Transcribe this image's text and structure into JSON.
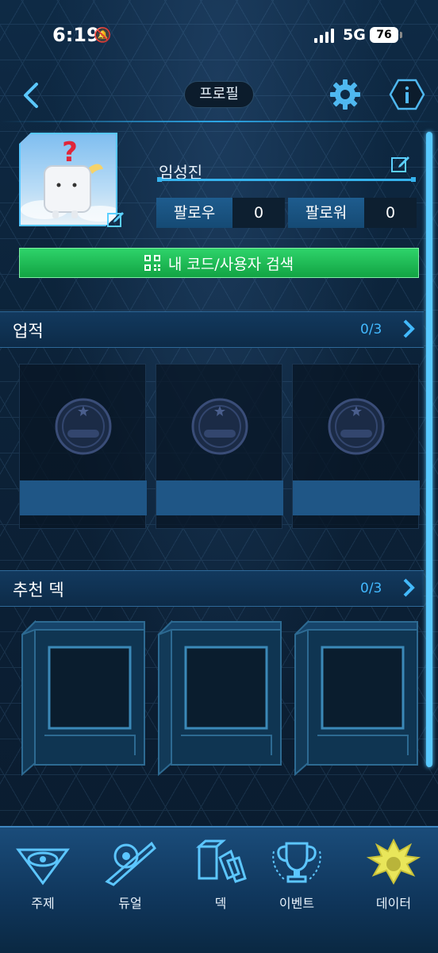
{
  "status_bar": {
    "time": "6:19",
    "network": "5G",
    "battery": "76"
  },
  "header": {
    "title": "프로필"
  },
  "profile": {
    "name": "임성진",
    "follow_label": "팔로우",
    "follow_value": "0",
    "follower_label": "팔로워",
    "follower_value": "0",
    "qr_button_label": "내 코드/사용자 검색"
  },
  "achievements": {
    "title": "업적",
    "count": "0/3"
  },
  "recommended_decks": {
    "title": "추천 덱",
    "count": "0/3"
  },
  "nav": {
    "items": [
      {
        "label": "주제",
        "icon": "millennium-eye-icon"
      },
      {
        "label": "듀얼",
        "icon": "duel-disk-icon"
      },
      {
        "label": "덱",
        "icon": "deck-icon"
      },
      {
        "label": "이벤트",
        "icon": "trophy-icon"
      },
      {
        "label": "데이터",
        "icon": "character-icon"
      }
    ]
  },
  "colors": {
    "accent": "#42b9ff",
    "green_button": "#1fbf56",
    "background": "#0c2238"
  }
}
